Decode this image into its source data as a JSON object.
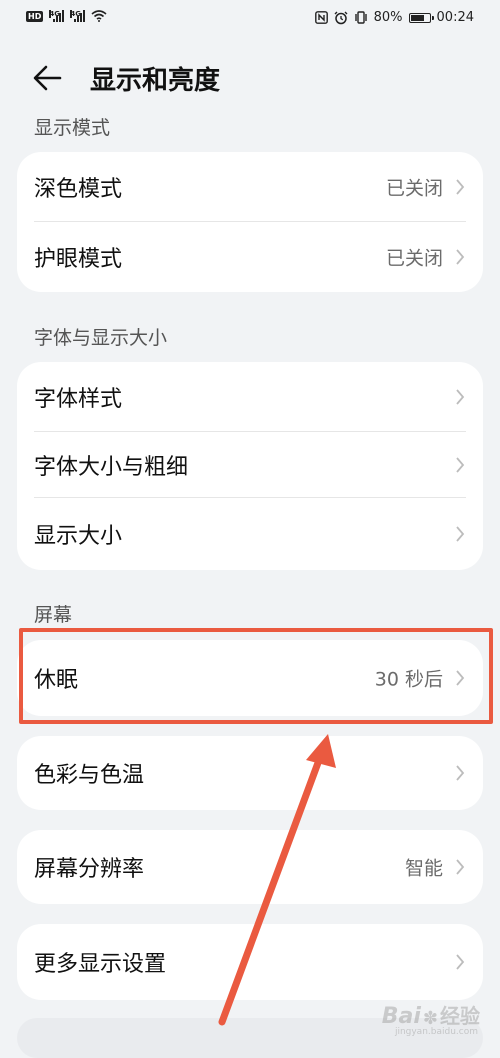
{
  "status_bar": {
    "network_badge": "HD",
    "sim1_gen": "4G",
    "sim2_gen": "4G",
    "battery_text": "80%",
    "battery_level": 0.8,
    "time": "00:24",
    "icons": [
      "nfc-icon",
      "alarm-icon",
      "vibrate-icon",
      "wifi-icon"
    ]
  },
  "header": {
    "title": "显示和亮度",
    "back_icon": "arrow-left-icon"
  },
  "sections": [
    {
      "label": "显示模式",
      "items": [
        {
          "label": "深色模式",
          "value": "已关闭"
        },
        {
          "label": "护眼模式",
          "value": "已关闭"
        }
      ]
    },
    {
      "label": "字体与显示大小",
      "items": [
        {
          "label": "字体样式",
          "value": ""
        },
        {
          "label": "字体大小与粗细",
          "value": ""
        },
        {
          "label": "显示大小",
          "value": ""
        }
      ]
    },
    {
      "label": "屏幕",
      "items": [
        {
          "label": "休眠",
          "value": "30 秒后"
        }
      ]
    }
  ],
  "extra_cards": [
    {
      "label": "色彩与色温",
      "value": ""
    },
    {
      "label": "屏幕分辨率",
      "value": "智能"
    },
    {
      "label": "更多显示设置",
      "value": ""
    }
  ],
  "colors": {
    "background": "#f1f3f5",
    "card": "#ffffff",
    "annotation": "#ea5a40"
  },
  "watermark": {
    "brand": "Bai",
    "cn": "经验",
    "url": "jingyan.baidu.com"
  }
}
